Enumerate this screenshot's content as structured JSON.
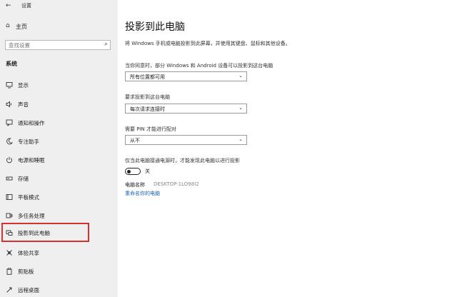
{
  "window": {
    "title": "设置"
  },
  "sidebar": {
    "home_label": "主页",
    "search_placeholder": "查找设置",
    "section": "系统",
    "items": [
      {
        "label": "显示",
        "icon": "display-icon"
      },
      {
        "label": "声音",
        "icon": "speaker-icon"
      },
      {
        "label": "通知和操作",
        "icon": "notification-icon"
      },
      {
        "label": "专注助手",
        "icon": "moon-icon"
      },
      {
        "label": "电源和睡眠",
        "icon": "power-icon"
      },
      {
        "label": "存储",
        "icon": "storage-icon"
      },
      {
        "label": "平板模式",
        "icon": "tablet-icon"
      },
      {
        "label": "多任务处理",
        "icon": "multitask-icon"
      },
      {
        "label": "投影到此电脑",
        "icon": "project-icon"
      },
      {
        "label": "体验共享",
        "icon": "share-icon"
      },
      {
        "label": "剪贴板",
        "icon": "clipboard-icon"
      },
      {
        "label": "远程桌面",
        "icon": "remote-desktop-icon"
      }
    ]
  },
  "main": {
    "title": "投影到此电脑",
    "description": "将 Windows 手机或电脑投影到此屏幕，并使用其键盘、鼠标和其他设备。",
    "setting1": {
      "label": "当你同意时，部分 Windows 和 Android 设备可以投影到这台电脑",
      "value": "所有位置都可用"
    },
    "setting2": {
      "label": "要求投影到这台电脑",
      "value": "每次请求连接时"
    },
    "setting3": {
      "label": "需要 PIN 才能进行配对",
      "value": "从不"
    },
    "power_option": {
      "label": "仅当此电脑接通电源时，才能发现此电脑以进行投影",
      "toggle_text": "关"
    },
    "pc_name": {
      "label": "电脑名称",
      "value": "DESKTOP-1LO98I2"
    },
    "rename_link": "重命名你的电脑"
  },
  "colors": {
    "highlight": "#d43131",
    "link": "#1a63b0",
    "sidebar_bg": "#efefef"
  }
}
